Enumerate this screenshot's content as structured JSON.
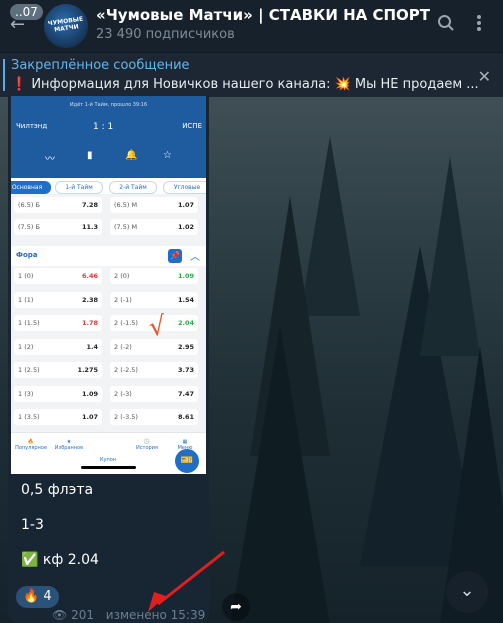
{
  "header": {
    "back_badge": "..07",
    "avatar_text": "ЧУМОВЫЕ МАТЧИ",
    "title": "«Чумовые Матчи» | СТАВКИ НА СПОРТ",
    "subscribers": "23 490 подписчиков"
  },
  "pinned": {
    "title": "Закреплённое сообщение",
    "text": "❗ Информация для Новичков нашего канала:  💥 Мы НЕ продаем ..."
  },
  "screenshot": {
    "match_line": "Идёт 1-й Тайм, прошло 39:16",
    "team_left": "Чилтэнд",
    "score": "1 : 1",
    "team_right": "ИСПЕ",
    "tabs": [
      "Основная игра",
      "1-й Тайм",
      "2-й Тайм",
      "Угловые"
    ],
    "totals_rows": [
      {
        "l1": "(6.5) Б",
        "v1": "7.28",
        "l2": "(6.5) М",
        "v2": "1.07"
      },
      {
        "l1": "(7.5) Б",
        "v1": "11.3",
        "l2": "(7.5) М",
        "v2": "1.02"
      }
    ],
    "fora_title": "Фора",
    "fora_rows": [
      {
        "l1": "1 (0)",
        "v1": "6.46",
        "c1": "#e03a3a",
        "l2": "2 (0)",
        "v2": "1.09",
        "c2": "#2bab4a"
      },
      {
        "l1": "1 (1)",
        "v1": "2.38",
        "c1": "#222222",
        "l2": "2 (-1)",
        "v2": "1.54",
        "c2": "#222222"
      },
      {
        "l1": "1 (1.5)",
        "v1": "1.78",
        "c1": "#e03a3a",
        "l2": "2 (-1.5)",
        "v2": "2.04",
        "c2": "#2bab4a"
      },
      {
        "l1": "1 (2)",
        "v1": "1.4",
        "c1": "#222222",
        "l2": "2 (-2)",
        "v2": "2.95",
        "c2": "#222222"
      },
      {
        "l1": "1 (2.5)",
        "v1": "1.275",
        "c1": "#222222",
        "l2": "2 (-2.5)",
        "v2": "3.73",
        "c2": "#222222"
      },
      {
        "l1": "1 (3)",
        "v1": "1.09",
        "c1": "#222222",
        "l2": "2 (-3)",
        "v2": "7.47",
        "c2": "#222222"
      },
      {
        "l1": "1 (3.5)",
        "v1": "1.07",
        "c1": "#222222",
        "l2": "2 (-3.5)",
        "v2": "8.61",
        "c2": "#222222"
      }
    ],
    "bottom_nav": [
      "Популярное",
      "Избранное",
      "Купон",
      "История",
      "Меню"
    ]
  },
  "message": {
    "line1": "0,5 флэта",
    "line2": "1-3",
    "line3": "✅ кф 2.04",
    "reaction_emoji": "🔥",
    "reaction_count": "4",
    "views": "201",
    "edited": "изменено 15:39"
  },
  "colors": {
    "header_bg": "#17212b",
    "bubble_bg": "#182533",
    "accent": "#64b5f0",
    "annotation_arrow": "#e02020"
  }
}
